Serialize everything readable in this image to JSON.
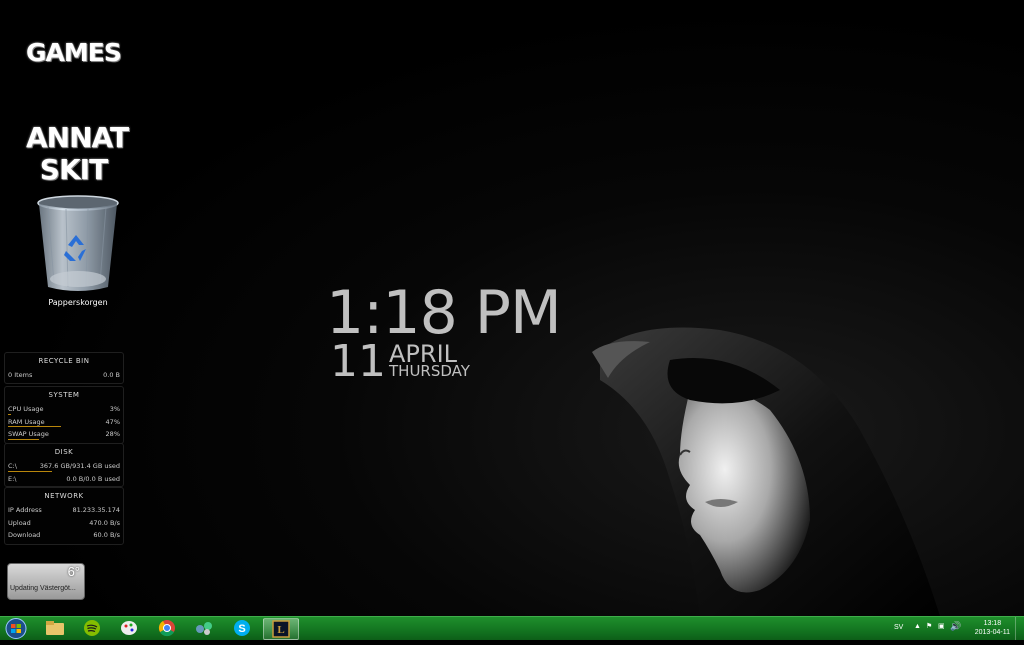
{
  "desktop": {
    "icons": {
      "games_label": "GAMES",
      "annat_line1": "ANNAT",
      "annat_line2": "SKIT",
      "recycle_bin_label": "Papperskorgen"
    },
    "clock": {
      "time": "1:18 PM",
      "day": "11",
      "month": "APRIL",
      "weekday": "THURSDAY"
    }
  },
  "monitor": {
    "recycle_bin": {
      "title": "RECYCLE BIN",
      "items_label": "0 Items",
      "size": "0.0 B"
    },
    "system": {
      "title": "SYSTEM",
      "cpu_label": "CPU Usage",
      "cpu_value": "3%",
      "cpu_fraction": 0.03,
      "ram_label": "RAM Usage",
      "ram_value": "47%",
      "ram_fraction": 0.47,
      "swap_label": "SWAP Usage",
      "swap_value": "28%",
      "swap_fraction": 0.28
    },
    "disk": {
      "title": "DISK",
      "c_label": "C:\\",
      "c_value": "367.6 GB/931.4 GB used",
      "c_fraction": 0.39,
      "e_label": "E:\\",
      "e_value": "0.0 B/0.0 B used",
      "e_fraction": 0.0
    },
    "network": {
      "title": "NETWORK",
      "ip_label": "IP Address",
      "ip_value": "81.233.35.174",
      "upload_label": "Upload",
      "upload_value": "470.0 B/s",
      "download_label": "Download",
      "download_value": "60.0 B/s"
    }
  },
  "weather": {
    "temperature": "6°",
    "status": "Updating Västergöt..."
  },
  "taskbar": {
    "pinned": [
      "start-orb-icon",
      "file-explorer-icon",
      "spotify-icon",
      "paint-icon",
      "chrome-icon",
      "network-app-icon",
      "skype-icon",
      "league-of-legends-icon"
    ],
    "active_index": 7,
    "tray": {
      "language": "SV",
      "time": "13:18",
      "date": "2013-04-11"
    }
  },
  "colors": {
    "taskbar_green": "#137420",
    "usage_bar": "#b8860b",
    "clock_text": "#c0c0c0"
  }
}
